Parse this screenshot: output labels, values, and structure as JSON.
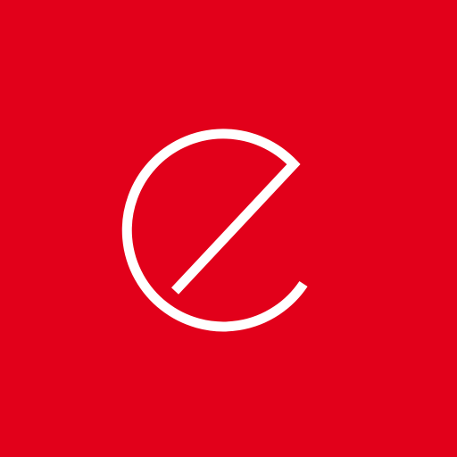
{
  "icon": {
    "name": "e-logo-icon",
    "background_color": "#E2001A",
    "mark_color": "#FFFFFF"
  }
}
